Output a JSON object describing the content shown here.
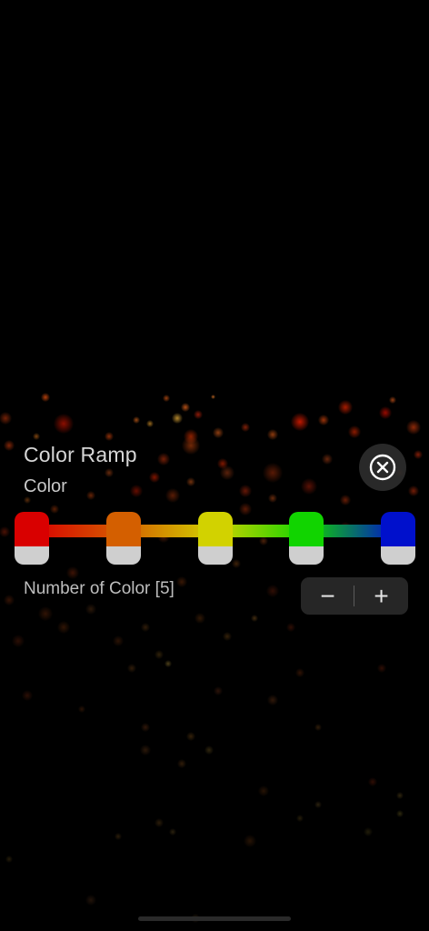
{
  "panel": {
    "title": "Color Ramp",
    "section_label": "Color",
    "close_icon": "close-circle-icon"
  },
  "color_ramp": {
    "stops": [
      {
        "color": "#d90000"
      },
      {
        "color": "#d45f00"
      },
      {
        "color": "#d2d200"
      },
      {
        "color": "#11d400"
      },
      {
        "color": "#0010cc"
      }
    ]
  },
  "stepper": {
    "label": "Number of Color [5]",
    "minus_label": "−",
    "plus_label": "+",
    "value": 5
  }
}
